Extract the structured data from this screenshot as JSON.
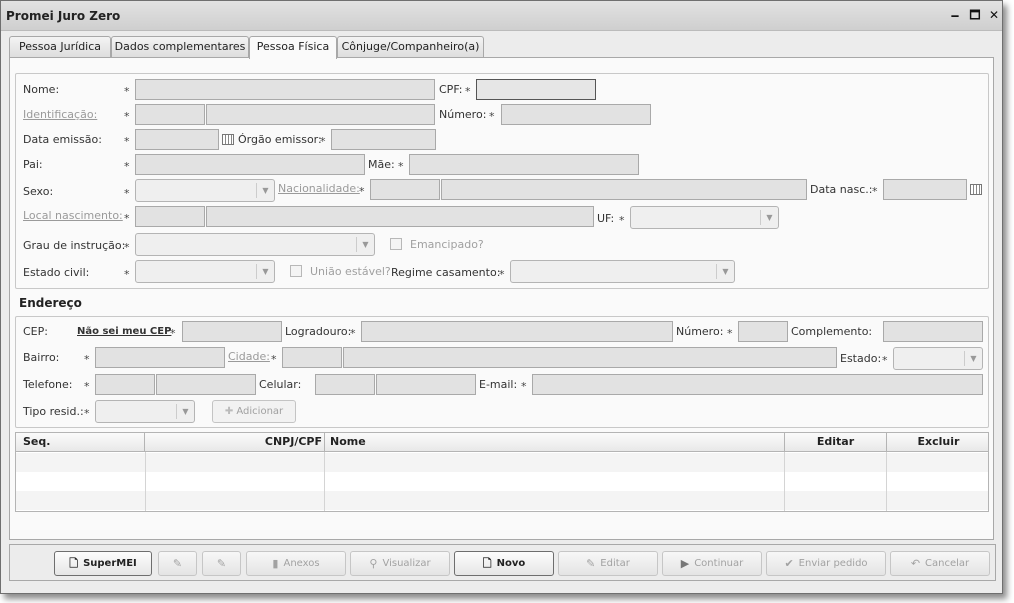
{
  "window": {
    "title": "Promei Juro Zero",
    "min": "🗕",
    "max": "🗖",
    "close": "✕"
  },
  "tabs": [
    "Pessoa Jurídica",
    "Dados complementares",
    "Pessoa Física",
    "Cônjuge/Companheiro(a)"
  ],
  "active_tab": "Pessoa Física",
  "person": {
    "nome": "Nome:",
    "cpf": "CPF:",
    "identificacao": "Identificação:",
    "numero": "Número:",
    "data_emissao": "Data emissão:",
    "orgao_emissor": "Órgão emissor:",
    "pai": "Pai:",
    "mae": "Mãe:",
    "sexo": "Sexo:",
    "nacionalidade": "Nacionalidade:",
    "data_nasc": "Data nasc.:",
    "local_nascimento": "Local nascimento:",
    "uf": "UF:",
    "grau_instrucao": "Grau de instrução:",
    "emancipado": "Emancipado?",
    "estado_civil": "Estado civil:",
    "uniao_estavel": "União estável?",
    "regime_casamento": "Regime casamento:"
  },
  "endereco": {
    "title": "Endereço",
    "cep": "CEP:",
    "nao_sei_cep": "Não sei meu CEP",
    "logradouro": "Logradouro:",
    "numero": "Número:",
    "complemento": "Complemento:",
    "bairro": "Bairro:",
    "cidade": "Cidade:",
    "estado": "Estado:",
    "telefone": "Telefone:",
    "celular": "Celular:",
    "email": "E-mail:",
    "tipo_resid": "Tipo resid.:",
    "adicionar": "Adicionar"
  },
  "table": {
    "columns": [
      "Seq.",
      "CNPJ/CPF",
      "Nome",
      "Editar",
      "Excluir"
    ],
    "rows": []
  },
  "footer_buttons": [
    {
      "label": "SuperMEI",
      "enabled": true,
      "icon": "document-icon"
    },
    {
      "label": "",
      "enabled": false,
      "icon": "edit-icon"
    },
    {
      "label": "",
      "enabled": false,
      "icon": "edit-icon"
    },
    {
      "label": "Anexos",
      "enabled": false,
      "icon": "paperclip-icon"
    },
    {
      "label": "Visualizar",
      "enabled": false,
      "icon": "magnifier-icon"
    },
    {
      "label": "Novo",
      "enabled": true,
      "icon": "new-document-icon"
    },
    {
      "label": "Editar",
      "enabled": false,
      "icon": "pencil-icon"
    },
    {
      "label": "Continuar",
      "enabled": false,
      "icon": "play-icon"
    },
    {
      "label": "Enviar pedido",
      "enabled": false,
      "icon": "check-icon"
    },
    {
      "label": "Cancelar",
      "enabled": false,
      "icon": "undo-icon"
    }
  ],
  "required_mark": "*"
}
